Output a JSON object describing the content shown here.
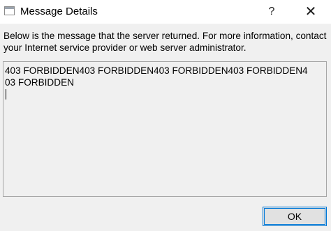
{
  "window": {
    "title": "Message Details",
    "icon": "window-icon",
    "help_label": "?",
    "close_label": "✕"
  },
  "dialog": {
    "description": "Below is the message that the server returned. For more information, contact your Internet service provider or web server administrator.",
    "message": "403 FORBIDDEN403 FORBIDDEN403 FORBIDDEN403 FORBIDDEN403 FORBIDDEN",
    "ok_label": "OK"
  },
  "colors": {
    "background": "#f0f0f0",
    "titlebar": "#ffffff",
    "accent_focus": "#0078d7",
    "button_face": "#e1e1e1"
  }
}
